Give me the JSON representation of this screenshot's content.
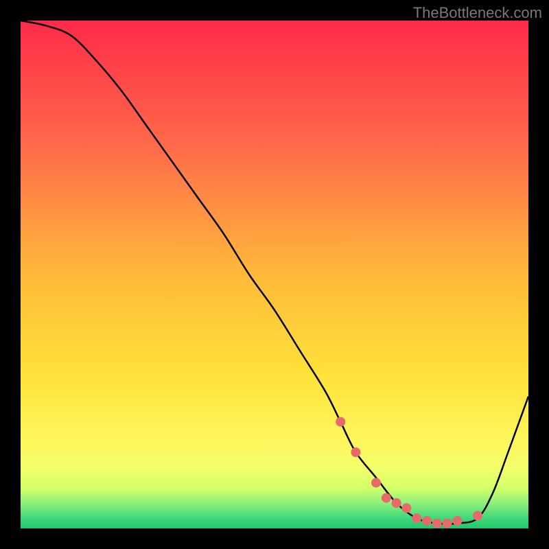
{
  "watermark": "TheBottleneck.com",
  "chart_data": {
    "type": "line",
    "title": "",
    "xlabel": "",
    "ylabel": "",
    "xlim": [
      0,
      100
    ],
    "ylim": [
      0,
      100
    ],
    "series": [
      {
        "name": "bottleneck-curve",
        "x": [
          0,
          5,
          10,
          15,
          20,
          25,
          30,
          35,
          40,
          45,
          50,
          55,
          60,
          63,
          66,
          70,
          74,
          78,
          82,
          86,
          90,
          93,
          96,
          100
        ],
        "values": [
          100,
          99,
          97,
          92,
          86,
          79,
          72,
          65,
          58,
          50,
          43,
          35,
          27,
          21,
          15,
          10,
          5,
          2,
          1,
          1,
          2,
          7,
          15,
          26
        ]
      }
    ],
    "markers": {
      "name": "highlight-dots",
      "x": [
        63,
        66,
        70,
        72,
        74,
        76,
        78,
        80,
        82,
        84,
        86,
        90
      ],
      "values": [
        21,
        15,
        9,
        6,
        5,
        4,
        2,
        1.5,
        1,
        1,
        1.5,
        2.5
      ]
    },
    "gradient_stops": [
      {
        "offset": 0.0,
        "color": "#ff2a4a"
      },
      {
        "offset": 0.25,
        "color": "#ff6b4a"
      },
      {
        "offset": 0.5,
        "color": "#ffb93a"
      },
      {
        "offset": 0.7,
        "color": "#ffe23a"
      },
      {
        "offset": 0.82,
        "color": "#fff55a"
      },
      {
        "offset": 0.88,
        "color": "#f3ff6a"
      },
      {
        "offset": 0.92,
        "color": "#d4ff6a"
      },
      {
        "offset": 0.95,
        "color": "#8ff07a"
      },
      {
        "offset": 0.98,
        "color": "#3fd87a"
      },
      {
        "offset": 1.0,
        "color": "#1fc76a"
      }
    ],
    "marker_color": "#e76a6a",
    "curve_color": "#000000"
  }
}
